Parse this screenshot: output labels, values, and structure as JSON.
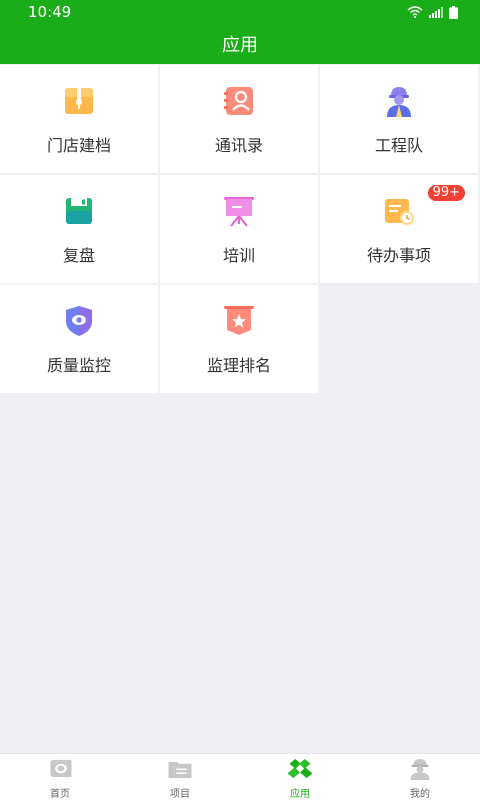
{
  "status_bar": {
    "time": "10:49"
  },
  "header": {
    "title": "应用",
    "color": "#1aad19"
  },
  "apps": [
    {
      "label": "门店建档",
      "icon": "store-archive-icon"
    },
    {
      "label": "通讯录",
      "icon": "contacts-icon"
    },
    {
      "label": "工程队",
      "icon": "engineering-team-icon"
    },
    {
      "label": "复盘",
      "icon": "review-icon"
    },
    {
      "label": "培训",
      "icon": "training-icon"
    },
    {
      "label": "待办事项",
      "icon": "todo-icon",
      "badge": "99+"
    },
    {
      "label": "质量监控",
      "icon": "quality-monitor-icon"
    },
    {
      "label": "监理排名",
      "icon": "supervision-ranking-icon"
    }
  ],
  "tabbar": {
    "items": [
      {
        "label": "首页",
        "icon": "home-icon",
        "active": false
      },
      {
        "label": "项目",
        "icon": "project-folder-icon",
        "active": false
      },
      {
        "label": "应用",
        "icon": "apps-icon",
        "active": true
      },
      {
        "label": "我的",
        "icon": "worker-profile-icon",
        "active": false
      }
    ]
  }
}
